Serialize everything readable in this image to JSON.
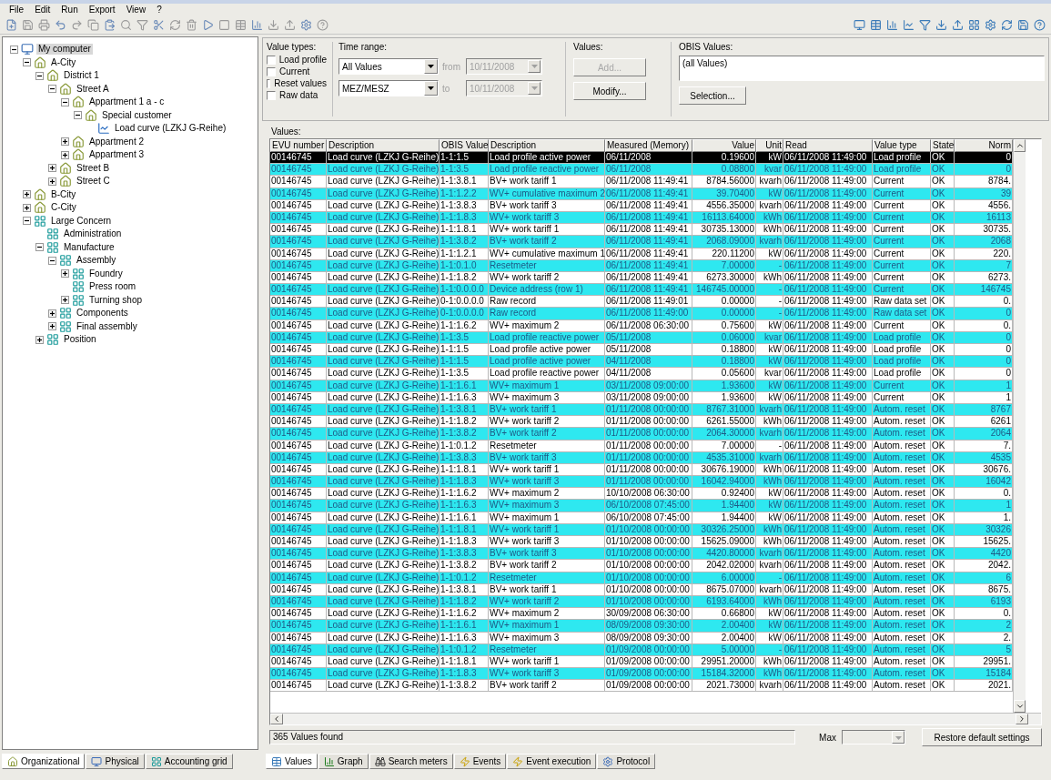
{
  "menu": [
    "File",
    "Edit",
    "Run",
    "Export",
    "View",
    "?"
  ],
  "tree": [
    {
      "label": "My computer",
      "kind": "computer",
      "selected": true,
      "expandable": true,
      "expanded": true,
      "children": [
        {
          "label": "A-City",
          "kind": "house",
          "selected": false,
          "expandable": true,
          "expanded": true,
          "children": [
            {
              "label": "District 1",
              "kind": "house",
              "selected": false,
              "expandable": true,
              "expanded": true,
              "children": [
                {
                  "label": "Street A",
                  "kind": "house",
                  "selected": false,
                  "expandable": true,
                  "expanded": true,
                  "children": [
                    {
                      "label": "Appartment 1 a - c",
                      "kind": "house",
                      "selected": false,
                      "expandable": true,
                      "expanded": true,
                      "children": [
                        {
                          "label": "Special customer",
                          "kind": "house",
                          "selected": false,
                          "expandable": true,
                          "expanded": true,
                          "children": [
                            {
                              "label": "Load curve (LZKJ G-Reihe)",
                              "kind": "curve",
                              "selected": false,
                              "expandable": false
                            }
                          ]
                        }
                      ]
                    },
                    {
                      "label": "Appartment 2",
                      "kind": "house",
                      "selected": false,
                      "expandable": true,
                      "expanded": false
                    },
                    {
                      "label": "Appartment 3",
                      "kind": "house",
                      "selected": false,
                      "expandable": true,
                      "expanded": false
                    }
                  ]
                },
                {
                  "label": "Street B",
                  "kind": "house",
                  "selected": false,
                  "expandable": true,
                  "expanded": false
                },
                {
                  "label": "Street C",
                  "kind": "house",
                  "selected": false,
                  "expandable": true,
                  "expanded": false
                }
              ]
            }
          ]
        },
        {
          "label": "B-City",
          "kind": "house",
          "selected": false,
          "expandable": true,
          "expanded": false
        },
        {
          "label": "C-City",
          "kind": "house",
          "selected": false,
          "expandable": true,
          "expanded": false
        },
        {
          "label": "Large Concern",
          "kind": "group",
          "selected": false,
          "expandable": true,
          "expanded": true,
          "children": [
            {
              "label": "Administration",
              "kind": "group",
              "selected": false,
              "expandable": false
            },
            {
              "label": "Manufacture",
              "kind": "group",
              "selected": false,
              "expandable": true,
              "expanded": true,
              "children": [
                {
                  "label": "Assembly",
                  "kind": "group",
                  "selected": false,
                  "expandable": true,
                  "expanded": true,
                  "children": [
                    {
                      "label": "Foundry",
                      "kind": "group",
                      "selected": false,
                      "expandable": true,
                      "expanded": false
                    },
                    {
                      "label": "Press room",
                      "kind": "group",
                      "selected": false,
                      "expandable": false
                    },
                    {
                      "label": "Turning shop",
                      "kind": "group",
                      "selected": false,
                      "expandable": true,
                      "expanded": false
                    }
                  ]
                },
                {
                  "label": "Components",
                  "kind": "group",
                  "selected": false,
                  "expandable": true,
                  "expanded": false
                },
                {
                  "label": "Final assembly",
                  "kind": "group",
                  "selected": false,
                  "expandable": true,
                  "expanded": false
                }
              ]
            },
            {
              "label": "Position",
              "kind": "group",
              "selected": false,
              "expandable": true,
              "expanded": false
            }
          ]
        }
      ]
    }
  ],
  "left_tabs": [
    {
      "label": "Organizational",
      "selected": true
    },
    {
      "label": "Physical",
      "selected": false
    },
    {
      "label": "Accounting grid",
      "selected": false
    }
  ],
  "value_types": {
    "title": "Value types:",
    "options": [
      {
        "label": "Load profile",
        "checked": false
      },
      {
        "label": "Current",
        "checked": false
      },
      {
        "label": "Reset values",
        "checked": false
      },
      {
        "label": "Raw data",
        "checked": false
      }
    ]
  },
  "time_range": {
    "title": "Time range:",
    "range": "All Values",
    "timezone": "MEZ/MESZ",
    "from_label": "from",
    "from": "10/11/2008",
    "to_label": "to",
    "to": "10/11/2008",
    "dates_disabled": true
  },
  "values_box": {
    "title": "Values:",
    "buttons": [
      {
        "label": "Add...",
        "disabled": true
      },
      {
        "label": "Modify...",
        "disabled": false
      }
    ]
  },
  "obis": {
    "title": "OBIS Values:",
    "value": "(all Values)",
    "button": "Selection..."
  },
  "table": {
    "title": "Values:",
    "columns": [
      "EVU number",
      "Description",
      "OBIS Value",
      "Description",
      "Measured (Memory)",
      "Value",
      "Unit",
      "Read",
      "Value type",
      "State",
      "Norm"
    ],
    "rows": [
      {
        "selected": true,
        "highlighted": false,
        "cells": [
          "00146745",
          "Load curve (LZKJ G-Reihe)",
          "1-1:1.5",
          "Load profile active power",
          "06/11/2008",
          "0.19600",
          "kW",
          "06/11/2008 11:49:00",
          "Load profile",
          "OK",
          "0"
        ]
      },
      {
        "selected": false,
        "highlighted": true,
        "cells": [
          "00146745",
          "Load curve (LZKJ G-Reihe)",
          "1-1:3.5",
          "Load profile reactive power",
          "06/11/2008",
          "0.08800",
          "kvar",
          "06/11/2008 11:49:00",
          "Load profile",
          "OK",
          "0"
        ]
      },
      {
        "selected": false,
        "highlighted": false,
        "cells": [
          "00146745",
          "Load curve (LZKJ G-Reihe)",
          "1-1:3.8.1",
          "BV+ work tariff 1",
          "06/11/2008 11:49:41",
          "8784.56000",
          "kvarh",
          "06/11/2008 11:49:00",
          "Current",
          "OK",
          "8784."
        ]
      },
      {
        "selected": false,
        "highlighted": true,
        "cells": [
          "00146745",
          "Load curve (LZKJ G-Reihe)",
          "1-1:1.2.2",
          "WV+ cumulative maximum 2",
          "06/11/2008 11:49:41",
          "39.70400",
          "kW",
          "06/11/2008 11:49:00",
          "Current",
          "OK",
          "39"
        ]
      },
      {
        "selected": false,
        "highlighted": false,
        "cells": [
          "00146745",
          "Load curve (LZKJ G-Reihe)",
          "1-1:3.8.3",
          "BV+ work tariff 3",
          "06/11/2008 11:49:41",
          "4556.35000",
          "kvarh",
          "06/11/2008 11:49:00",
          "Current",
          "OK",
          "4556."
        ]
      },
      {
        "selected": false,
        "highlighted": true,
        "cells": [
          "00146745",
          "Load curve (LZKJ G-Reihe)",
          "1-1:1.8.3",
          "WV+ work tariff 3",
          "06/11/2008 11:49:41",
          "16113.64000",
          "kWh",
          "06/11/2008 11:49:00",
          "Current",
          "OK",
          "16113"
        ]
      },
      {
        "selected": false,
        "highlighted": false,
        "cells": [
          "00146745",
          "Load curve (LZKJ G-Reihe)",
          "1-1:1.8.1",
          "WV+ work tariff 1",
          "06/11/2008 11:49:41",
          "30735.13000",
          "kWh",
          "06/11/2008 11:49:00",
          "Current",
          "OK",
          "30735."
        ]
      },
      {
        "selected": false,
        "highlighted": true,
        "cells": [
          "00146745",
          "Load curve (LZKJ G-Reihe)",
          "1-1:3.8.2",
          "BV+ work tariff 2",
          "06/11/2008 11:49:41",
          "2068.09000",
          "kvarh",
          "06/11/2008 11:49:00",
          "Current",
          "OK",
          "2068"
        ]
      },
      {
        "selected": false,
        "highlighted": false,
        "cells": [
          "00146745",
          "Load curve (LZKJ G-Reihe)",
          "1-1:1.2.1",
          "WV+ cumulative maximum 1",
          "06/11/2008 11:49:41",
          "220.11200",
          "kW",
          "06/11/2008 11:49:00",
          "Current",
          "OK",
          "220."
        ]
      },
      {
        "selected": false,
        "highlighted": true,
        "cells": [
          "00146745",
          "Load curve (LZKJ G-Reihe)",
          "1-1:0.1.0",
          "Resetmeter",
          "06/11/2008 11:49:41",
          "7.00000",
          "-",
          "06/11/2008 11:49:00",
          "Current",
          "OK",
          "7"
        ]
      },
      {
        "selected": false,
        "highlighted": false,
        "cells": [
          "00146745",
          "Load curve (LZKJ G-Reihe)",
          "1-1:1.8.2",
          "WV+ work tariff 2",
          "06/11/2008 11:49:41",
          "6273.30000",
          "kWh",
          "06/11/2008 11:49:00",
          "Current",
          "OK",
          "6273."
        ]
      },
      {
        "selected": false,
        "highlighted": true,
        "cells": [
          "00146745",
          "Load curve (LZKJ G-Reihe)",
          "1-1:0.0.0.0",
          "Device address (row 1)",
          "06/11/2008 11:49:41",
          "146745.00000",
          "-",
          "06/11/2008 11:49:00",
          "Current",
          "OK",
          "146745"
        ]
      },
      {
        "selected": false,
        "highlighted": false,
        "cells": [
          "00146745",
          "Load curve (LZKJ G-Reihe)",
          "0-1:0.0.0.0",
          "Raw record",
          "06/11/2008 11:49:01",
          "0.00000",
          "-",
          "06/11/2008 11:49:00",
          "Raw data set",
          "OK",
          "0."
        ]
      },
      {
        "selected": false,
        "highlighted": true,
        "cells": [
          "00146745",
          "Load curve (LZKJ G-Reihe)",
          "0-1:0.0.0.0",
          "Raw record",
          "06/11/2008 11:49:00",
          "0.00000",
          "-",
          "06/11/2008 11:49:00",
          "Raw data set",
          "OK",
          "0"
        ]
      },
      {
        "selected": false,
        "highlighted": false,
        "cells": [
          "00146745",
          "Load curve (LZKJ G-Reihe)",
          "1-1:1.6.2",
          "WV+ maximum 2",
          "06/11/2008 06:30:00",
          "0.75600",
          "kW",
          "06/11/2008 11:49:00",
          "Current",
          "OK",
          "0."
        ]
      },
      {
        "selected": false,
        "highlighted": true,
        "cells": [
          "00146745",
          "Load curve (LZKJ G-Reihe)",
          "1-1:3.5",
          "Load profile reactive power",
          "05/11/2008",
          "0.06000",
          "kvar",
          "06/11/2008 11:49:00",
          "Load profile",
          "OK",
          "0"
        ]
      },
      {
        "selected": false,
        "highlighted": false,
        "cells": [
          "00146745",
          "Load curve (LZKJ G-Reihe)",
          "1-1:1.5",
          "Load profile active power",
          "05/11/2008",
          "0.18800",
          "kW",
          "06/11/2008 11:49:00",
          "Load profile",
          "OK",
          "0"
        ]
      },
      {
        "selected": false,
        "highlighted": true,
        "cells": [
          "00146745",
          "Load curve (LZKJ G-Reihe)",
          "1-1:1.5",
          "Load profile active power",
          "04/11/2008",
          "0.18800",
          "kW",
          "06/11/2008 11:49:00",
          "Load profile",
          "OK",
          "0"
        ]
      },
      {
        "selected": false,
        "highlighted": false,
        "cells": [
          "00146745",
          "Load curve (LZKJ G-Reihe)",
          "1-1:3.5",
          "Load profile reactive power",
          "04/11/2008",
          "0.05600",
          "kvar",
          "06/11/2008 11:49:00",
          "Load profile",
          "OK",
          "0"
        ]
      },
      {
        "selected": false,
        "highlighted": true,
        "cells": [
          "00146745",
          "Load curve (LZKJ G-Reihe)",
          "1-1:1.6.1",
          "WV+ maximum 1",
          "03/11/2008 09:00:00",
          "1.93600",
          "kW",
          "06/11/2008 11:49:00",
          "Current",
          "OK",
          "1"
        ]
      },
      {
        "selected": false,
        "highlighted": false,
        "cells": [
          "00146745",
          "Load curve (LZKJ G-Reihe)",
          "1-1:1.6.3",
          "WV+ maximum 3",
          "03/11/2008 09:00:00",
          "1.93600",
          "kW",
          "06/11/2008 11:49:00",
          "Current",
          "OK",
          "1"
        ]
      },
      {
        "selected": false,
        "highlighted": true,
        "cells": [
          "00146745",
          "Load curve (LZKJ G-Reihe)",
          "1-1:3.8.1",
          "BV+ work tariff 1",
          "01/11/2008 00:00:00",
          "8767.31000",
          "kvarh",
          "06/11/2008 11:49:00",
          "Autom. reset",
          "OK",
          "8767"
        ]
      },
      {
        "selected": false,
        "highlighted": false,
        "cells": [
          "00146745",
          "Load curve (LZKJ G-Reihe)",
          "1-1:1.8.2",
          "WV+ work tariff 2",
          "01/11/2008 00:00:00",
          "6261.55000",
          "kWh",
          "06/11/2008 11:49:00",
          "Autom. reset",
          "OK",
          "6261"
        ]
      },
      {
        "selected": false,
        "highlighted": true,
        "cells": [
          "00146745",
          "Load curve (LZKJ G-Reihe)",
          "1-1:3.8.2",
          "BV+ work tariff 2",
          "01/11/2008 00:00:00",
          "2064.30000",
          "kvarh",
          "06/11/2008 11:49:00",
          "Autom. reset",
          "OK",
          "2064"
        ]
      },
      {
        "selected": false,
        "highlighted": false,
        "cells": [
          "00146745",
          "Load curve (LZKJ G-Reihe)",
          "1-1:0.1.2",
          "Resetmeter",
          "01/11/2008 00:00:00",
          "7.00000",
          "-",
          "06/11/2008 11:49:00",
          "Autom. reset",
          "OK",
          "7."
        ]
      },
      {
        "selected": false,
        "highlighted": true,
        "cells": [
          "00146745",
          "Load curve (LZKJ G-Reihe)",
          "1-1:3.8.3",
          "BV+ work tariff 3",
          "01/11/2008 00:00:00",
          "4535.31000",
          "kvarh",
          "06/11/2008 11:49:00",
          "Autom. reset",
          "OK",
          "4535"
        ]
      },
      {
        "selected": false,
        "highlighted": false,
        "cells": [
          "00146745",
          "Load curve (LZKJ G-Reihe)",
          "1-1:1.8.1",
          "WV+ work tariff 1",
          "01/11/2008 00:00:00",
          "30676.19000",
          "kWh",
          "06/11/2008 11:49:00",
          "Autom. reset",
          "OK",
          "30676."
        ]
      },
      {
        "selected": false,
        "highlighted": true,
        "cells": [
          "00146745",
          "Load curve (LZKJ G-Reihe)",
          "1-1:1.8.3",
          "WV+ work tariff 3",
          "01/11/2008 00:00:00",
          "16042.94000",
          "kWh",
          "06/11/2008 11:49:00",
          "Autom. reset",
          "OK",
          "16042"
        ]
      },
      {
        "selected": false,
        "highlighted": false,
        "cells": [
          "00146745",
          "Load curve (LZKJ G-Reihe)",
          "1-1:1.6.2",
          "WV+ maximum 2",
          "10/10/2008 06:30:00",
          "0.92400",
          "kW",
          "06/11/2008 11:49:00",
          "Autom. reset",
          "OK",
          "0."
        ]
      },
      {
        "selected": false,
        "highlighted": true,
        "cells": [
          "00146745",
          "Load curve (LZKJ G-Reihe)",
          "1-1:1.6.3",
          "WV+ maximum 3",
          "06/10/2008 07:45:00",
          "1.94400",
          "kW",
          "06/11/2008 11:49:00",
          "Autom. reset",
          "OK",
          "1"
        ]
      },
      {
        "selected": false,
        "highlighted": false,
        "cells": [
          "00146745",
          "Load curve (LZKJ G-Reihe)",
          "1-1:1.6.1",
          "WV+ maximum 1",
          "06/10/2008 07:45:00",
          "1.94400",
          "kW",
          "06/11/2008 11:49:00",
          "Autom. reset",
          "OK",
          "1."
        ]
      },
      {
        "selected": false,
        "highlighted": true,
        "cells": [
          "00146745",
          "Load curve (LZKJ G-Reihe)",
          "1-1:1.8.1",
          "WV+ work tariff 1",
          "01/10/2008 00:00:00",
          "30326.25000",
          "kWh",
          "06/11/2008 11:49:00",
          "Autom. reset",
          "OK",
          "30326"
        ]
      },
      {
        "selected": false,
        "highlighted": false,
        "cells": [
          "00146745",
          "Load curve (LZKJ G-Reihe)",
          "1-1:1.8.3",
          "WV+ work tariff 3",
          "01/10/2008 00:00:00",
          "15625.09000",
          "kWh",
          "06/11/2008 11:49:00",
          "Autom. reset",
          "OK",
          "15625."
        ]
      },
      {
        "selected": false,
        "highlighted": true,
        "cells": [
          "00146745",
          "Load curve (LZKJ G-Reihe)",
          "1-1:3.8.3",
          "BV+ work tariff 3",
          "01/10/2008 00:00:00",
          "4420.80000",
          "kvarh",
          "06/11/2008 11:49:00",
          "Autom. reset",
          "OK",
          "4420"
        ]
      },
      {
        "selected": false,
        "highlighted": false,
        "cells": [
          "00146745",
          "Load curve (LZKJ G-Reihe)",
          "1-1:3.8.2",
          "BV+ work tariff 2",
          "01/10/2008 00:00:00",
          "2042.02000",
          "kvarh",
          "06/11/2008 11:49:00",
          "Autom. reset",
          "OK",
          "2042."
        ]
      },
      {
        "selected": false,
        "highlighted": true,
        "cells": [
          "00146745",
          "Load curve (LZKJ G-Reihe)",
          "1-1:0.1.2",
          "Resetmeter",
          "01/10/2008 00:00:00",
          "6.00000",
          "-",
          "06/11/2008 11:49:00",
          "Autom. reset",
          "OK",
          "6"
        ]
      },
      {
        "selected": false,
        "highlighted": false,
        "cells": [
          "00146745",
          "Load curve (LZKJ G-Reihe)",
          "1-1:3.8.1",
          "BV+ work tariff 1",
          "01/10/2008 00:00:00",
          "8675.07000",
          "kvarh",
          "06/11/2008 11:49:00",
          "Autom. reset",
          "OK",
          "8675."
        ]
      },
      {
        "selected": false,
        "highlighted": true,
        "cells": [
          "00146745",
          "Load curve (LZKJ G-Reihe)",
          "1-1:1.8.2",
          "WV+ work tariff 2",
          "01/10/2008 00:00:00",
          "6193.64000",
          "kWh",
          "06/11/2008 11:49:00",
          "Autom. reset",
          "OK",
          "6193"
        ]
      },
      {
        "selected": false,
        "highlighted": false,
        "cells": [
          "00146745",
          "Load curve (LZKJ G-Reihe)",
          "1-1:1.6.2",
          "WV+ maximum 2",
          "30/09/2008 06:30:00",
          "0.66800",
          "kW",
          "06/11/2008 11:49:00",
          "Autom. reset",
          "OK",
          "0."
        ]
      },
      {
        "selected": false,
        "highlighted": true,
        "cells": [
          "00146745",
          "Load curve (LZKJ G-Reihe)",
          "1-1:1.6.1",
          "WV+ maximum 1",
          "08/09/2008 09:30:00",
          "2.00400",
          "kW",
          "06/11/2008 11:49:00",
          "Autom. reset",
          "OK",
          "2"
        ]
      },
      {
        "selected": false,
        "highlighted": false,
        "cells": [
          "00146745",
          "Load curve (LZKJ G-Reihe)",
          "1-1:1.6.3",
          "WV+ maximum 3",
          "08/09/2008 09:30:00",
          "2.00400",
          "kW",
          "06/11/2008 11:49:00",
          "Autom. reset",
          "OK",
          "2."
        ]
      },
      {
        "selected": false,
        "highlighted": true,
        "cells": [
          "00146745",
          "Load curve (LZKJ G-Reihe)",
          "1-1:0.1.2",
          "Resetmeter",
          "01/09/2008 00:00:00",
          "5.00000",
          "-",
          "06/11/2008 11:49:00",
          "Autom. reset",
          "OK",
          "5"
        ]
      },
      {
        "selected": false,
        "highlighted": false,
        "cells": [
          "00146745",
          "Load curve (LZKJ G-Reihe)",
          "1-1:1.8.1",
          "WV+ work tariff 1",
          "01/09/2008 00:00:00",
          "29951.20000",
          "kWh",
          "06/11/2008 11:49:00",
          "Autom. reset",
          "OK",
          "29951."
        ]
      },
      {
        "selected": false,
        "highlighted": true,
        "cells": [
          "00146745",
          "Load curve (LZKJ G-Reihe)",
          "1-1:1.8.3",
          "WV+ work tariff 3",
          "01/09/2008 00:00:00",
          "15184.32000",
          "kWh",
          "06/11/2008 11:49:00",
          "Autom. reset",
          "OK",
          "15184"
        ]
      },
      {
        "selected": false,
        "highlighted": false,
        "cells": [
          "00146745",
          "Load curve (LZKJ G-Reihe)",
          "1-1:3.8.2",
          "BV+ work tariff 2",
          "01/09/2008 00:00:00",
          "2021.73000",
          "kvarh",
          "06/11/2008 11:49:00",
          "Autom. reset",
          "OK",
          "2021."
        ]
      }
    ]
  },
  "status": {
    "count": "365 Values found",
    "max_label": "Max",
    "max_disabled": true,
    "restore": "Restore default settings"
  },
  "right_tabs": [
    {
      "label": "Values",
      "selected": true
    },
    {
      "label": "Graph",
      "selected": false
    },
    {
      "label": "Search meters",
      "selected": false
    },
    {
      "label": "Events",
      "selected": false
    },
    {
      "label": "Event execution",
      "selected": false
    },
    {
      "label": "Protocol",
      "selected": false
    }
  ]
}
